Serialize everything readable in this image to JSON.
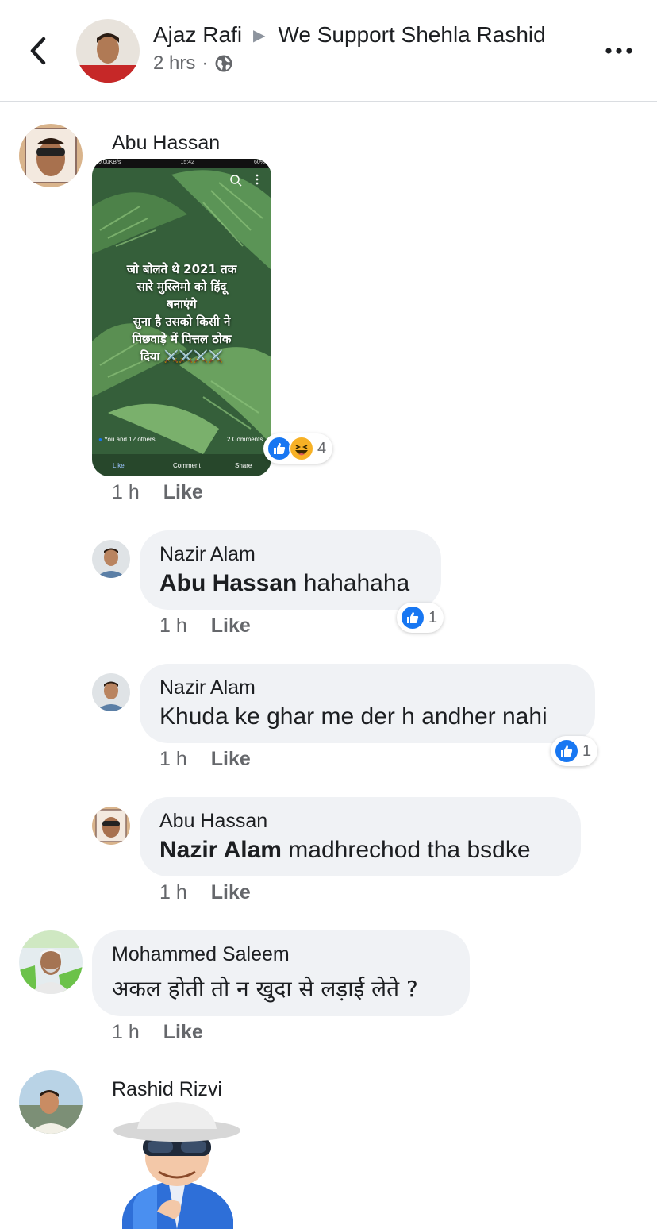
{
  "header": {
    "author": "Ajaz Rafi",
    "group": "We Support Shehla Rashid",
    "time": "2 hrs",
    "dot": "·"
  },
  "comments": [
    {
      "author": "Abu Hassan",
      "attachment": {
        "status_left": "0.00KB/s",
        "status_time": "15:42",
        "status_right": "60%",
        "text_lines": [
          "जो बोलते थे 2021 तक",
          "सारे मुस्लिमो को हिंदू",
          "बनाएंगे",
          "सुना है उसको किसी ने",
          "पिछवाड़े में पित्तल ठोक",
          "दिया ⚔️⚔️⚔️⚔️"
        ],
        "reactions_text": "You and 12 others",
        "comments_text": "2 Comments",
        "action_like": "Like",
        "action_comment": "Comment",
        "action_share": "Share"
      },
      "reaction_count": "4",
      "time": "1 h",
      "like_label": "Like"
    },
    {
      "author": "Nazir Alam",
      "mention": "Abu Hassan",
      "text": "hahahaha",
      "reaction_count": "1",
      "time": "1 h",
      "like_label": "Like"
    },
    {
      "author": "Nazir Alam",
      "text": "Khuda ke ghar me der h andher nahi",
      "reaction_count": "1",
      "time": "1 h",
      "like_label": "Like"
    },
    {
      "author": "Abu Hassan",
      "mention": "Nazir Alam",
      "text": "madhrechod tha bsdke",
      "time": "1 h",
      "like_label": "Like"
    },
    {
      "author": "Mohammed Saleem",
      "text": "अकल होती तो न खुदा से लड़ाई लेते ?",
      "time": "1 h",
      "like_label": "Like"
    },
    {
      "author": "Rashid Rizvi"
    }
  ],
  "colors": {
    "like_blue": "#1877f2",
    "bubble_bg": "#f0f2f5",
    "meta_gray": "#65676b"
  },
  "icons": [
    "back-chevron-icon",
    "globe-icon",
    "more-options-icon",
    "like-reaction-icon",
    "haha-reaction-icon"
  ]
}
